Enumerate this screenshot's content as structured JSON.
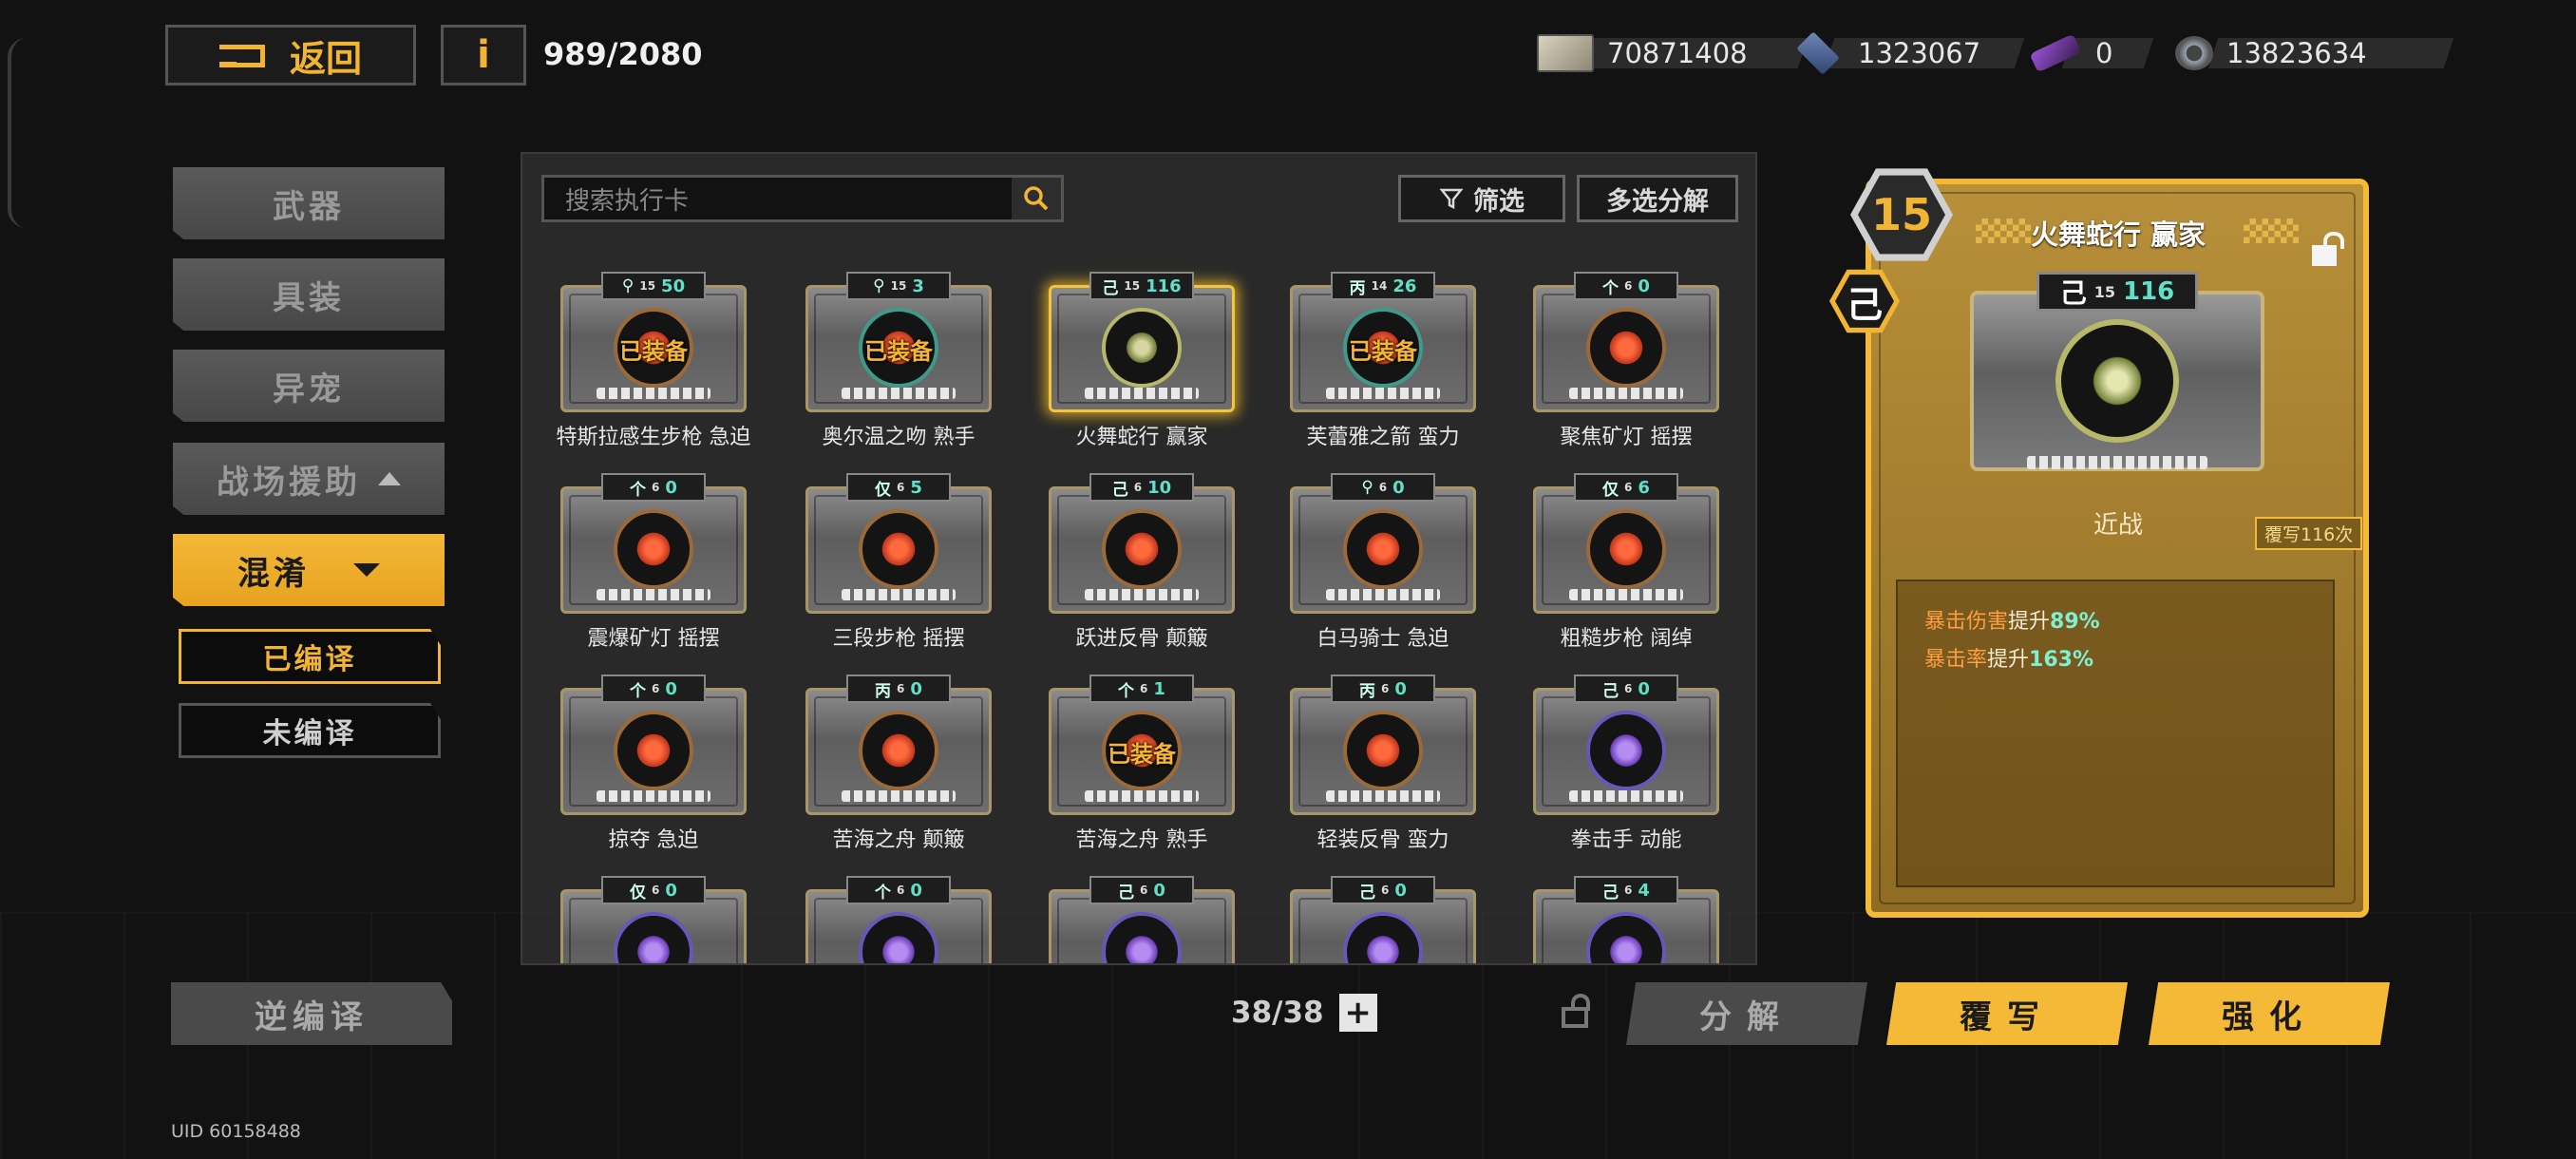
{
  "top_bar": {
    "back_label": "返回",
    "info_label": "i",
    "capacity": "989/2080",
    "currencies": [
      {
        "icon": "cash-icon",
        "value": "70871408"
      },
      {
        "icon": "cube-icon",
        "value": "1323067"
      },
      {
        "icon": "chip-icon",
        "value": "0"
      },
      {
        "icon": "gear-icon",
        "value": "13823634"
      }
    ]
  },
  "sidebar": {
    "categories": [
      "武器",
      "具装",
      "异宠",
      "战场援助"
    ],
    "active": "混淆",
    "sub_filters": [
      "已编译",
      "未编译"
    ]
  },
  "panel": {
    "search_placeholder": "搜索执行卡",
    "filter_label": "筛选",
    "multi_decompose_label": "多选分解",
    "cards": [
      {
        "rune": "⚲",
        "level": "15",
        "rewrite": "50",
        "name": "特斯拉感生步枪 急迫",
        "equipped": "已装备",
        "glyph": "orange"
      },
      {
        "rune": "⚲",
        "level": "15",
        "rewrite": "3",
        "name": "奥尔温之吻 熟手",
        "equipped": "已装备",
        "glyph": "teal"
      },
      {
        "rune": "己",
        "level": "15",
        "rewrite": "116",
        "name": "火舞蛇行 赢家",
        "equipped": "",
        "glyph": "green",
        "selected": true
      },
      {
        "rune": "丙",
        "level": "14",
        "rewrite": "26",
        "name": "芙蕾雅之箭 蛮力",
        "equipped": "已装备",
        "glyph": "teal"
      },
      {
        "rune": "个",
        "level": "6",
        "rewrite": "0",
        "name": "聚焦矿灯 摇摆",
        "equipped": "",
        "glyph": "orange"
      },
      {
        "rune": "个",
        "level": "6",
        "rewrite": "0",
        "name": "震爆矿灯 摇摆",
        "equipped": "",
        "glyph": "orange"
      },
      {
        "rune": "仅",
        "level": "6",
        "rewrite": "5",
        "name": "三段步枪 摇摆",
        "equipped": "",
        "glyph": "orange"
      },
      {
        "rune": "己",
        "level": "6",
        "rewrite": "10",
        "name": "跃进反骨 颠簸",
        "equipped": "",
        "glyph": "orange"
      },
      {
        "rune": "⚲",
        "level": "6",
        "rewrite": "0",
        "name": "白马骑士 急迫",
        "equipped": "",
        "glyph": "orange"
      },
      {
        "rune": "仅",
        "level": "6",
        "rewrite": "6",
        "name": "粗糙步枪 阔绰",
        "equipped": "",
        "glyph": "orange"
      },
      {
        "rune": "个",
        "level": "6",
        "rewrite": "0",
        "name": "掠夺 急迫",
        "equipped": "",
        "glyph": "orange"
      },
      {
        "rune": "丙",
        "level": "6",
        "rewrite": "0",
        "name": "苦海之舟 颠簸",
        "equipped": "",
        "glyph": "orange"
      },
      {
        "rune": "个",
        "level": "6",
        "rewrite": "1",
        "name": "苦海之舟 熟手",
        "equipped": "已装备",
        "glyph": "orange"
      },
      {
        "rune": "丙",
        "level": "6",
        "rewrite": "0",
        "name": "轻装反骨 蛮力",
        "equipped": "",
        "glyph": "orange"
      },
      {
        "rune": "己",
        "level": "6",
        "rewrite": "0",
        "name": "拳击手 动能",
        "equipped": "",
        "glyph": "purple"
      },
      {
        "rune": "仅",
        "level": "6",
        "rewrite": "0",
        "name": "",
        "equipped": "",
        "glyph": "purple"
      },
      {
        "rune": "个",
        "level": "6",
        "rewrite": "0",
        "name": "",
        "equipped": "",
        "glyph": "purple"
      },
      {
        "rune": "己",
        "level": "6",
        "rewrite": "0",
        "name": "",
        "equipped": "",
        "glyph": "purple"
      },
      {
        "rune": "己",
        "level": "6",
        "rewrite": "0",
        "name": "",
        "equipped": "",
        "glyph": "purple"
      },
      {
        "rune": "己",
        "level": "6",
        "rewrite": "4",
        "name": "",
        "equipped": "",
        "glyph": "purple"
      }
    ]
  },
  "bottom": {
    "decompile_label": "逆编译",
    "count": "38/38",
    "plus_label": "+",
    "decompose_label": "分解",
    "overwrite_label": "覆写",
    "enhance_label": "强化",
    "uid": "UID 60158488"
  },
  "detail": {
    "level": "15",
    "rune": "己",
    "title": "火舞蛇行 赢家",
    "card_level": "15",
    "card_rewrite": "116",
    "type": "近战",
    "overwrite_count": "覆写116次",
    "stats": [
      {
        "key": "暴击伤害",
        "mid": "提升",
        "val": "89%"
      },
      {
        "key": "暴击率",
        "mid": "提升",
        "val": "163%"
      }
    ]
  },
  "colors": {
    "accent": "#f2b533",
    "rewrite": "#5fe1c9",
    "stat_key": "#ff9f40"
  }
}
